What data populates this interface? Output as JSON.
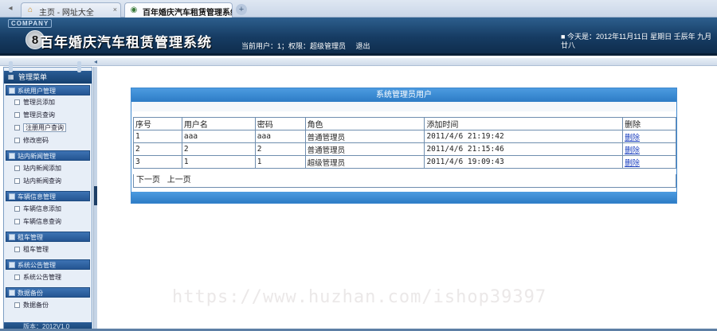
{
  "browser": {
    "tabs": [
      {
        "label": "主页 - 网址大全",
        "icon": "home-icon"
      },
      {
        "label": "百年婚庆汽车租赁管理系统",
        "icon": "page-icon"
      }
    ],
    "close_glyph": "×",
    "new_tab_glyph": "+"
  },
  "header": {
    "company": "COMPANY",
    "logo_glyph": "8",
    "title": "百年婚庆汽车租赁管理系统",
    "user_info": "当前用户：1；权限：超级管理员",
    "logout": "退出",
    "date_info": "今天是：2012年11月11日 星期日 壬辰年 九月廿八"
  },
  "sidebar": {
    "header": "管理菜单",
    "groups": [
      {
        "label": "系统用户管理",
        "items": [
          "管理员添加",
          "管理员查询",
          "注册用户查询",
          "修改密码"
        ]
      },
      {
        "label": "站内新闻管理",
        "items": [
          "站内新闻添加",
          "站内新闻查询"
        ]
      },
      {
        "label": "车辆信息管理",
        "items": [
          "车辆信息添加",
          "车辆信息查询"
        ]
      },
      {
        "label": "租车管理",
        "items": [
          "租车管理"
        ]
      },
      {
        "label": "系统公告管理",
        "items": [
          "系统公告管理"
        ]
      },
      {
        "label": "数据备份",
        "items": [
          "数据备份"
        ]
      }
    ],
    "footer": "版本：2012V1.0"
  },
  "panel": {
    "title": "系统管理员用户",
    "columns": [
      "序号",
      "用户名",
      "密码",
      "角色",
      "添加时间",
      "删除"
    ],
    "rows": [
      {
        "id": "1",
        "username": "aaa",
        "password": "aaa",
        "role": "普通管理员",
        "time": "2011/4/6 21:19:42",
        "action": "删除"
      },
      {
        "id": "2",
        "username": "2",
        "password": "2",
        "role": "普通管理员",
        "time": "2011/4/6 21:15:46",
        "action": "删除"
      },
      {
        "id": "3",
        "username": "1",
        "password": "1",
        "role": "超级管理员",
        "time": "2011/4/6 19:09:43",
        "action": "删除"
      }
    ],
    "pager": {
      "next": "下一页",
      "prev": "上一页"
    }
  },
  "watermark": "https://www.huzhan.com/ishop39397",
  "colors": {
    "header_bg": "#163c63",
    "panel_accent": "#3f88cf",
    "link": "#1a3fbf"
  }
}
